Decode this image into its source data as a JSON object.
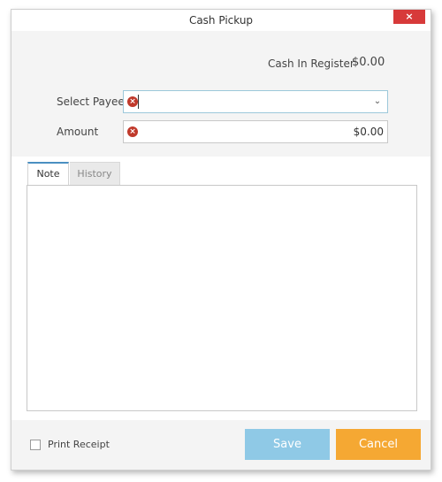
{
  "window": {
    "title": "Cash Pickup",
    "close_label": "×"
  },
  "register": {
    "label": "Cash In Register",
    "value": "$0.00"
  },
  "form": {
    "payee_label": "Select Payee",
    "payee_value": "",
    "amount_label": "Amount",
    "amount_value": "$0.00",
    "error_glyph": "×"
  },
  "tabs": {
    "items": [
      {
        "label": "Note",
        "active": true
      },
      {
        "label": "History",
        "active": false
      }
    ]
  },
  "note": {
    "value": ""
  },
  "footer": {
    "print_receipt_label": "Print Receipt",
    "print_receipt_checked": false,
    "save_label": "Save",
    "cancel_label": "Cancel"
  },
  "icons": {
    "dropdown": "chevron-down-icon",
    "error": "error-icon",
    "close": "close-icon"
  },
  "colors": {
    "save_button": "#8fc9e6",
    "cancel_button": "#f5a833",
    "close_button": "#d73a3a",
    "error_icon": "#c0392b",
    "active_tab_accent": "#4a8fc1"
  }
}
